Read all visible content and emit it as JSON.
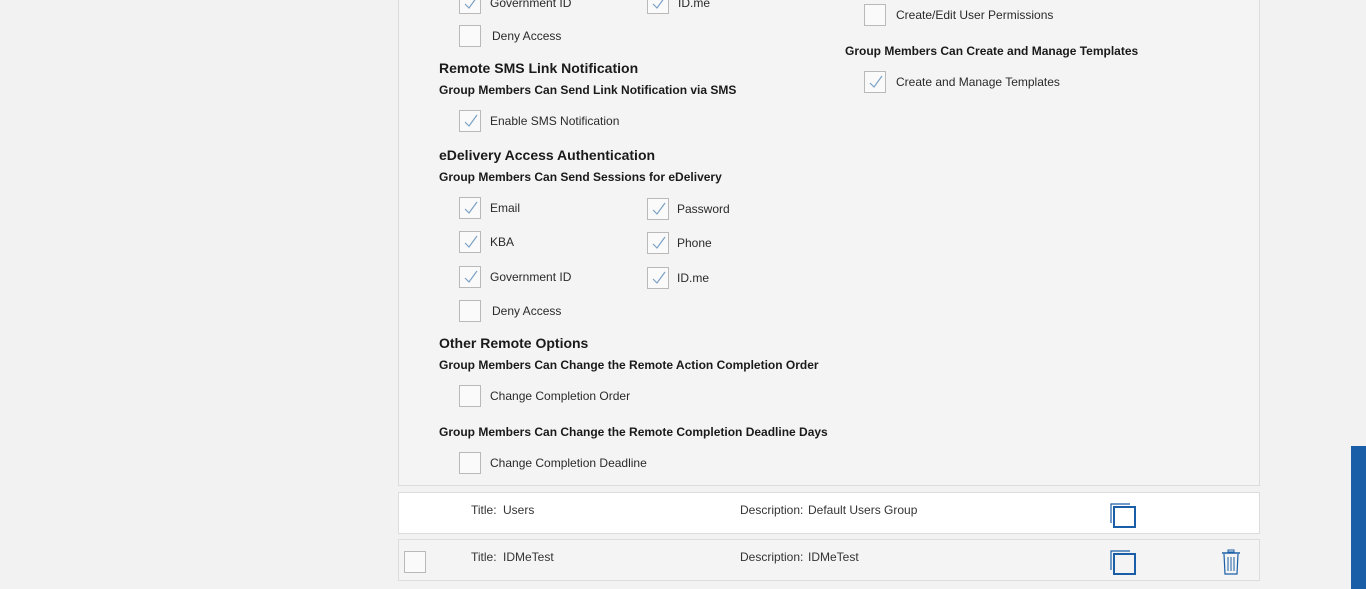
{
  "top_partial": {
    "government_id": {
      "label": "Government ID",
      "checked": true
    },
    "idme": {
      "label": "ID.me",
      "checked": true
    },
    "deny_access": {
      "label": "Deny Access",
      "checked": false
    }
  },
  "remote_sms": {
    "heading": "Remote SMS Link Notification",
    "subheading": "Group Members Can Send Link Notification via SMS",
    "enable_sms": {
      "label": "Enable SMS Notification",
      "checked": true
    }
  },
  "edelivery": {
    "heading": "eDelivery Access Authentication",
    "subheading": "Group Members Can Send Sessions for eDelivery",
    "email": {
      "label": "Email",
      "checked": true
    },
    "password": {
      "label": "Password",
      "checked": true
    },
    "kba": {
      "label": "KBA",
      "checked": true
    },
    "phone": {
      "label": "Phone",
      "checked": true
    },
    "government_id": {
      "label": "Government ID",
      "checked": true
    },
    "idme": {
      "label": "ID.me",
      "checked": true
    },
    "deny_access": {
      "label": "Deny Access",
      "checked": false
    }
  },
  "other_remote": {
    "heading": "Other Remote Options",
    "completion_order_sub": "Group Members Can Change the Remote Action Completion Order",
    "change_completion_order": {
      "label": "Change Completion Order",
      "checked": false
    },
    "deadline_sub": "Group Members Can Change the Remote Completion Deadline Days",
    "change_completion_deadline": {
      "label": "Change Completion Deadline",
      "checked": false
    }
  },
  "right_column": {
    "create_edit_perms": {
      "label": "Create/Edit User Permissions",
      "checked": false
    },
    "templates_sub": "Group Members Can Create and Manage Templates",
    "create_manage_templates": {
      "label": "Create and Manage Templates",
      "checked": true
    }
  },
  "groups": [
    {
      "title_label": "Title:",
      "title": "Users",
      "desc_label": "Description:",
      "description": "Default Users Group"
    },
    {
      "title_label": "Title:",
      "title": "IDMeTest",
      "desc_label": "Description:",
      "description": "IDMeTest"
    }
  ],
  "icons": {
    "check": "check-icon",
    "copy": "copy-icon",
    "trash": "trash-icon"
  },
  "colors": {
    "accent": "#1a5ea8",
    "checkmark": "#7aa0c4"
  }
}
